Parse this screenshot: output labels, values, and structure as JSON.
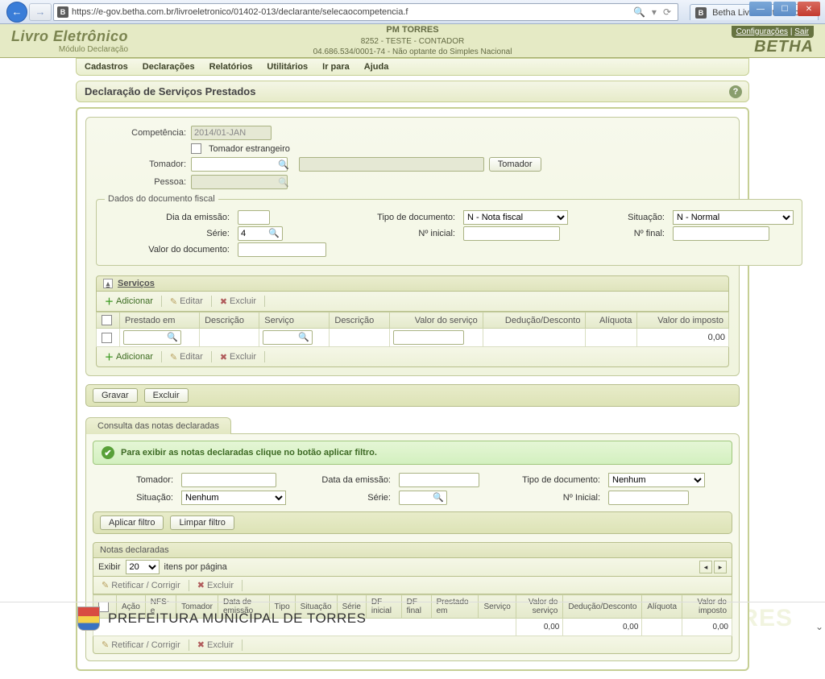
{
  "browser": {
    "url": "https://e-gov.betha.com.br/livroeletronico/01402-013/declarante/selecaocompetencia.f",
    "url_icon": "B",
    "tab_title": "Betha Livro Eletrônico",
    "tab_icon": "B"
  },
  "header": {
    "logo_title": "Livro Eletrônico",
    "logo_sub": "Módulo Declaração",
    "center_line1": "PM TORRES",
    "center_line2": "8252 - TESTE - CONTADOR",
    "center_line3": "04.686.534/0001-74 - Não optante do Simples Nacional",
    "link_config": "Configurações",
    "link_exit": "Sair",
    "brand": "BETHA"
  },
  "menu": {
    "items": [
      "Cadastros",
      "Declarações",
      "Relatórios",
      "Utilitários",
      "Ir para",
      "Ajuda"
    ]
  },
  "page": {
    "title": "Declaração de Serviços Prestados"
  },
  "form": {
    "lbl_competencia": "Competência:",
    "val_competencia": "2014/01-JAN",
    "lbl_tomador_estr": "Tomador estrangeiro",
    "lbl_tomador": "Tomador:",
    "btn_tomador": "Tomador",
    "lbl_pessoa": "Pessoa:",
    "fieldset_title": "Dados do documento fiscal",
    "lbl_dia": "Dia da emissão:",
    "lbl_tipo": "Tipo de documento:",
    "val_tipo": "N - Nota fiscal",
    "lbl_situacao": "Situação:",
    "val_situacao": "N - Normal",
    "lbl_serie": "Série:",
    "val_serie": "4",
    "lbl_ninicial": "Nº inicial:",
    "lbl_nfinal": "Nº final:",
    "lbl_valor_doc": "Valor do documento:"
  },
  "servicos": {
    "title": "Serviços",
    "btn_add": "Adicionar",
    "btn_edit": "Editar",
    "btn_del": "Excluir",
    "cols": [
      "",
      "Prestado em",
      "Descrição",
      "Serviço",
      "Descrição",
      "Valor do serviço",
      "Dedução/Desconto",
      "Alíquota",
      "Valor do imposto"
    ],
    "imposto_val": "0,00"
  },
  "actions": {
    "gravar": "Gravar",
    "excluir": "Excluir"
  },
  "consulta": {
    "tab": "Consulta das notas declaradas",
    "info": "Para exibir as notas declaradas clique no botão aplicar filtro.",
    "lbl_tomador": "Tomador:",
    "lbl_data": "Data da emissão:",
    "lbl_tipo": "Tipo de documento:",
    "val_tipo": "Nenhum",
    "lbl_situacao": "Situação:",
    "val_situacao": "Nenhum",
    "lbl_serie": "Série:",
    "lbl_ninicial": "Nº Inicial:",
    "btn_aplicar": "Aplicar filtro",
    "btn_limpar": "Limpar filtro"
  },
  "notas": {
    "title": "Notas declaradas",
    "exibir": "Exibir",
    "pagesize": "20",
    "itens": "itens por página",
    "btn_retificar": "Retificar / Corrigir",
    "btn_excluir": "Excluir",
    "cols": [
      "",
      "Ação",
      "NFS-e",
      "Tomador",
      "Data de emissão",
      "Tipo",
      "Situação",
      "Série",
      "DF inicial",
      "DF final",
      "Prestado em",
      "Serviço",
      "Valor do serviço",
      "Dedução/Desconto",
      "Alíquota",
      "Valor do imposto"
    ],
    "sum_valor_servico": "0,00",
    "sum_deducao": "0,00",
    "sum_imposto": "0,00"
  },
  "footer": {
    "prefeitura": "PREFEITURA MUNICIPAL DE TORRES",
    "watermark": "MUNICIPAL DE TORRES"
  }
}
